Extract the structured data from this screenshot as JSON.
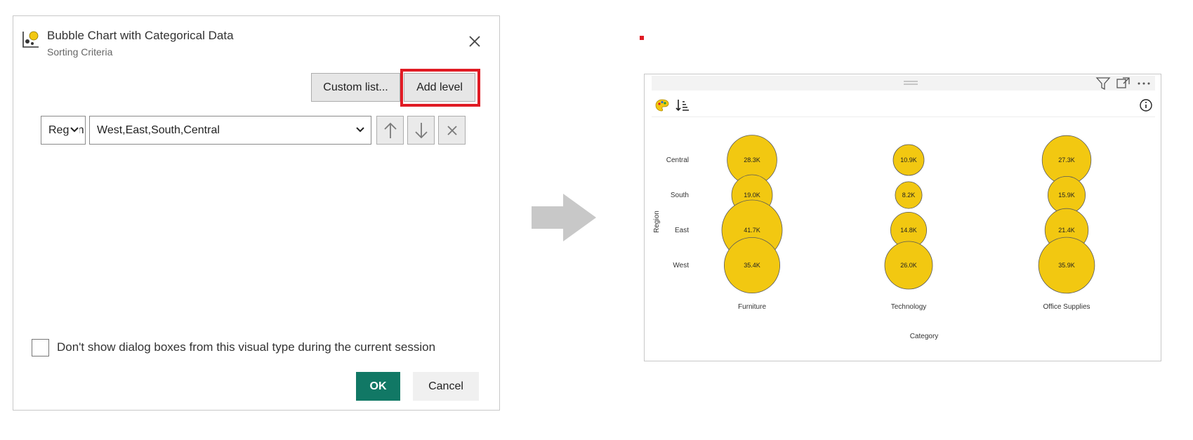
{
  "dialog": {
    "title": "Bubble Chart with Categorical Data",
    "subtitle": "Sorting Criteria",
    "custom_list_label": "Custom list...",
    "add_level_label": "Add level",
    "level_select_value": "Region",
    "order_select_value": "West,East,South,Central",
    "checkbox_label": "Don't show dialog boxes from this visual type during the current session",
    "ok_label": "OK",
    "cancel_label": "Cancel"
  },
  "icons": {
    "close": "close-icon",
    "move_up": "arrow-up-icon",
    "move_down": "arrow-down-icon",
    "remove": "close-icon",
    "filter": "filter-icon",
    "focus": "focus-mode-icon",
    "more": "more-options-icon",
    "palette": "palette-icon",
    "sort": "sort-icon",
    "info": "info-icon"
  },
  "colors": {
    "bubble_fill": "#F2C811",
    "ok_button": "#117865",
    "highlight": "#E01B24"
  },
  "chart_data": {
    "type": "scatter",
    "title": "",
    "xlabel": "Category",
    "ylabel": "Region",
    "categories": [
      "Furniture",
      "Technology",
      "Office Supplies"
    ],
    "regions": [
      "Central",
      "South",
      "East",
      "West"
    ],
    "points": [
      {
        "category": "Furniture",
        "region": "Central",
        "value": 28.3,
        "label": "28.3K"
      },
      {
        "category": "Furniture",
        "region": "South",
        "value": 19.0,
        "label": "19.0K"
      },
      {
        "category": "Furniture",
        "region": "East",
        "value": 41.7,
        "label": "41.7K"
      },
      {
        "category": "Furniture",
        "region": "West",
        "value": 35.4,
        "label": "35.4K"
      },
      {
        "category": "Technology",
        "region": "Central",
        "value": 10.9,
        "label": "10.9K"
      },
      {
        "category": "Technology",
        "region": "South",
        "value": 8.2,
        "label": "8.2K"
      },
      {
        "category": "Technology",
        "region": "East",
        "value": 14.8,
        "label": "14.8K"
      },
      {
        "category": "Technology",
        "region": "West",
        "value": 26.0,
        "label": "26.0K"
      },
      {
        "category": "Office Supplies",
        "region": "Central",
        "value": 27.3,
        "label": "27.3K"
      },
      {
        "category": "Office Supplies",
        "region": "South",
        "value": 15.9,
        "label": "15.9K"
      },
      {
        "category": "Office Supplies",
        "region": "East",
        "value": 21.4,
        "label": "21.4K"
      },
      {
        "category": "Office Supplies",
        "region": "West",
        "value": 35.9,
        "label": "35.9K"
      }
    ]
  }
}
